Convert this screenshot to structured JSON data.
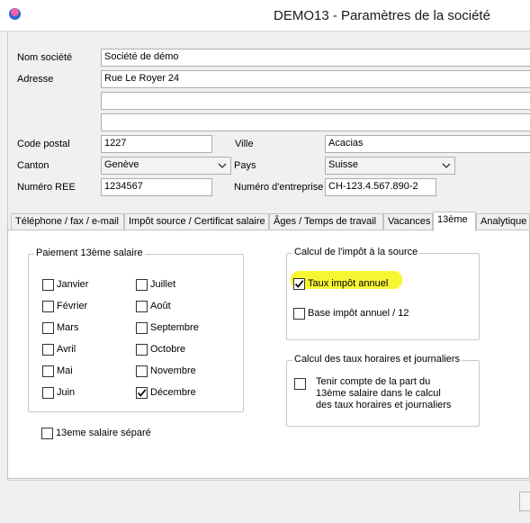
{
  "window": {
    "title": "DEMO13 - Paramètres de la société"
  },
  "form": {
    "company_label": "Nom société",
    "company_value": "Société de démo",
    "address_label": "Adresse",
    "address_line1": "Rue Le Royer 24",
    "address_line2": "",
    "address_line3": "",
    "postal_label": "Code postal",
    "postal_value": "1227",
    "city_label": "Ville",
    "city_value": "Acacias",
    "canton_label": "Canton",
    "canton_value": "Genève",
    "country_label": "Pays",
    "country_value": "Suisse",
    "ree_label": "Numéro REE",
    "ree_value": "1234567",
    "enterprise_label": "Numéro d'entreprise",
    "enterprise_value": "CH-123.4.567.890-2"
  },
  "tabs": [
    {
      "label": "Téléphone / fax / e-mail",
      "active": false
    },
    {
      "label": "Impôt source / Certificat salaire",
      "active": false
    },
    {
      "label": "Âges / Temps de travail",
      "active": false
    },
    {
      "label": "Vacances",
      "active": false
    },
    {
      "label": "13ème",
      "active": true
    },
    {
      "label": "Analytique",
      "active": false
    }
  ],
  "payment_group": {
    "title": "Paiement 13ème salaire",
    "months": [
      {
        "label": "Janvier",
        "checked": false
      },
      {
        "label": "Février",
        "checked": false
      },
      {
        "label": "Mars",
        "checked": false
      },
      {
        "label": "Avril",
        "checked": false
      },
      {
        "label": "Mai",
        "checked": false
      },
      {
        "label": "Juin",
        "checked": false
      },
      {
        "label": "Juillet",
        "checked": false
      },
      {
        "label": "Août",
        "checked": false
      },
      {
        "label": "Septembre",
        "checked": false
      },
      {
        "label": "Octobre",
        "checked": false
      },
      {
        "label": "Novembre",
        "checked": false
      },
      {
        "label": "Décembre",
        "checked": true
      }
    ]
  },
  "separate": {
    "label": "13eme salaire séparé",
    "checked": false
  },
  "tax_group": {
    "title": "Calcul  de l'impôt à la source",
    "annual_rate_label": "Taux impôt annuel",
    "annual_rate_checked": true,
    "annual_base_label": "Base impôt annuel / 12",
    "annual_base_checked": false,
    "highlight_color": "#f6f632"
  },
  "hourly_group": {
    "title": "Calcul des taux horaires et journaliers",
    "line1": "Tenir compte de la part du",
    "line2": "13ème salaire dans le calcul",
    "line3": "des taux horaires et journaliers",
    "checked": false
  }
}
